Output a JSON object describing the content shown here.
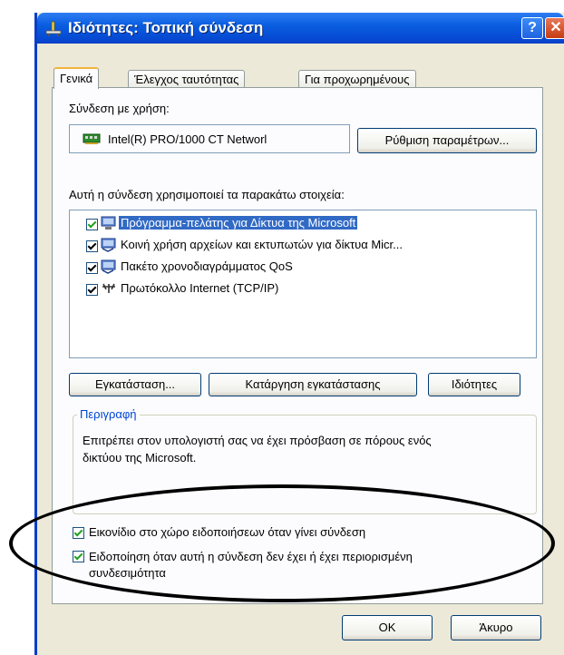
{
  "window": {
    "title": "Ιδιότητες: Τοπική σύνδεση",
    "help_button": "?",
    "close_button": "✕"
  },
  "tabs": [
    {
      "label": "Γενικά",
      "active": true
    },
    {
      "label": "Έλεγχος ταυτότητας",
      "active": false
    },
    {
      "label": "Για προχωρημένους",
      "active": false
    }
  ],
  "general": {
    "connect_using_label": "Σύνδεση με χρήση:",
    "adapter_name": "Intel(R) PRO/1000 CT Networl",
    "configure_button": "Ρύθμιση παραμέτρων...",
    "items_label": "Αυτή η σύνδεση χρησιμοποιεί τα παρακάτω στοιχεία:",
    "items": [
      {
        "label": "Πρόγραμμα-πελάτης για Δίκτυα της Microsoft",
        "checked": true,
        "selected": true,
        "icon": "network-client-icon"
      },
      {
        "label": "Κοινή χρήση αρχείων και εκτυπωτών για δίκτυα Micr...",
        "checked": true,
        "selected": false,
        "icon": "file-printer-sharing-icon"
      },
      {
        "label": "Πακέτο χρονοδιαγράμματος QoS",
        "checked": true,
        "selected": false,
        "icon": "qos-scheduler-icon"
      },
      {
        "label": "Πρωτόκολλο Internet (TCP/IP)",
        "checked": true,
        "selected": false,
        "icon": "protocol-icon"
      }
    ],
    "install_button": "Εγκατάσταση...",
    "uninstall_button": "Κατάργηση εγκατάστασης",
    "properties_button": "Ιδιότητες",
    "description_title": "Περιγραφή",
    "description_text": "Επιτρέπει στον υπολογιστή σας να έχει πρόσβαση σε πόρους ενός δικτύου της Microsoft.",
    "show_icon_label": "Εικονίδιο στο χώρο ειδοποιήσεων όταν γίνει σύνδεση",
    "show_icon_checked": true,
    "notify_label": "Ειδοποίηση όταν αυτή η σύνδεση δεν έχει ή έχει περιορισμένη συνδεσιμότητα",
    "notify_checked": true
  },
  "footer": {
    "ok_button": "OK",
    "cancel_button": "Άκυρο"
  },
  "colors": {
    "title_bar": "#0a5ee0",
    "selection": "#316ac5",
    "group_title": "#0046d5",
    "active_tab_accent": "#f1b43c"
  }
}
